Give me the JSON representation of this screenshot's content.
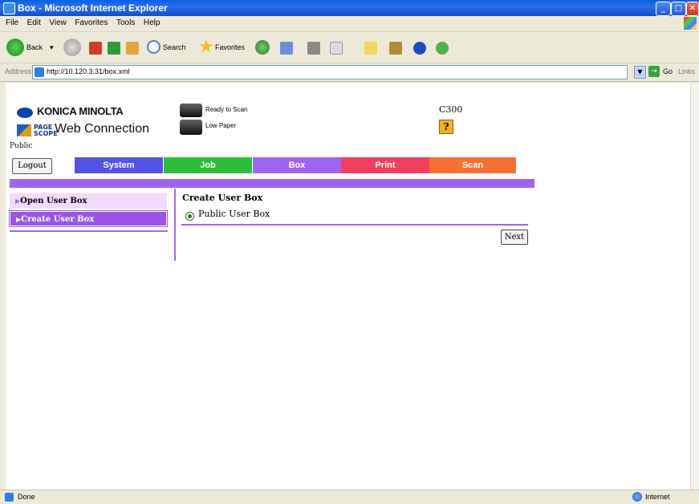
{
  "window": {
    "title": "Box - Microsoft Internet Explorer"
  },
  "menu": [
    "File",
    "Edit",
    "View",
    "Favorites",
    "Tools",
    "Help"
  ],
  "toolbar": {
    "back": "Back",
    "search": "Search",
    "favorites": "Favorites"
  },
  "address": {
    "label": "Address",
    "url": "http://10.120.3.31/box.xml",
    "go": "Go",
    "links": "Links"
  },
  "page": {
    "brand": "KONICA MINOLTA",
    "pagescope": "PAGE SCOPE",
    "web_connection": "Web Connection",
    "role": "Public",
    "status": [
      {
        "text": "Ready to Scan",
        "icon": "printer-icon"
      },
      {
        "text": "Low Paper",
        "icon": "printer-warning-icon"
      }
    ],
    "model": "C300",
    "help_label": "?",
    "logout": "Logout",
    "tabs": [
      {
        "label": "System",
        "color": "#5552e6"
      },
      {
        "label": "Job",
        "color": "#2ebd3a"
      },
      {
        "label": "Box",
        "color": "#a065ef"
      },
      {
        "label": "Print",
        "color": "#f0405e"
      },
      {
        "label": "Scan",
        "color": "#f47036"
      }
    ],
    "sidebar": [
      {
        "label": "Open User Box",
        "active": false
      },
      {
        "label": "Create User Box",
        "active": true
      }
    ],
    "main_title": "Create User Box",
    "option": "Public User Box",
    "next": "Next"
  },
  "statusbar": {
    "left": "Done",
    "right": "Internet"
  }
}
